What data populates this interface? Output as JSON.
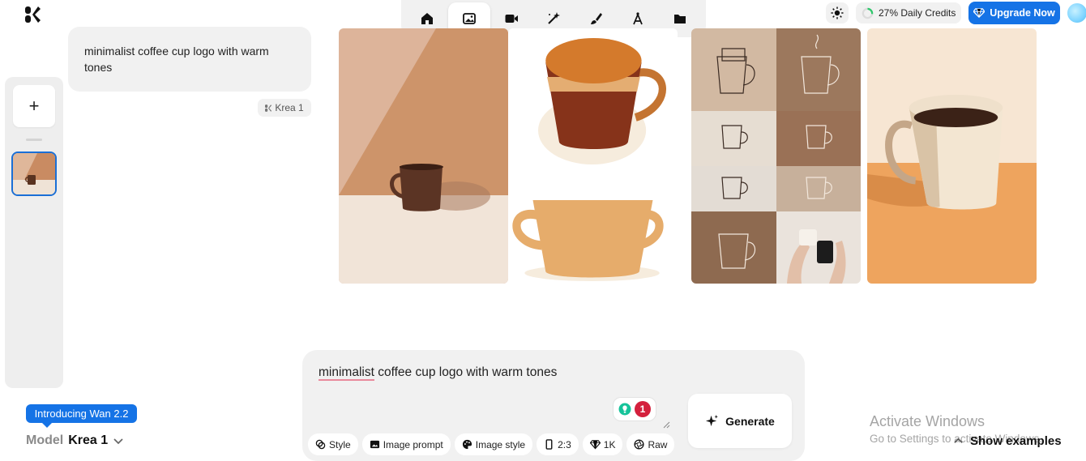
{
  "toolbar": {
    "items": [
      {
        "name": "home",
        "icon": "home-icon",
        "active": false
      },
      {
        "name": "image",
        "icon": "image-icon",
        "active": true
      },
      {
        "name": "video",
        "icon": "video-camera-icon",
        "active": false
      },
      {
        "name": "enhance",
        "icon": "magic-wand-icon",
        "active": false
      },
      {
        "name": "edit",
        "icon": "brush-icon",
        "active": false
      },
      {
        "name": "design",
        "icon": "compass-icon",
        "active": false
      },
      {
        "name": "assets",
        "icon": "folder-icon",
        "active": false
      }
    ]
  },
  "header": {
    "credits_label": "27% Daily Credits",
    "credits_percent": 27,
    "upgrade_label": "Upgrade Now",
    "accent_color": "#1573e6"
  },
  "sidebar": {
    "add_label": "+"
  },
  "chat": {
    "user_prompt": "minimalist coffee cup logo with warm tones",
    "model_tag": "Krea 1"
  },
  "composer": {
    "prompt_first_word": "minimalist",
    "prompt_rest": " coffee cup logo with warm tones",
    "extension_badge_count": "1",
    "chips": [
      {
        "label": "Style",
        "icon": "style-icon"
      },
      {
        "label": "Image prompt",
        "icon": "image-prompt-icon"
      },
      {
        "label": "Image style",
        "icon": "palette-icon"
      },
      {
        "label": "2:3",
        "icon": "aspect-ratio-icon"
      },
      {
        "label": "1K",
        "icon": "diamond-icon"
      },
      {
        "label": "Raw",
        "icon": "aperture-icon"
      }
    ],
    "generate_label": "Generate"
  },
  "footer": {
    "intro_tip": "Introducing Wan 2.2",
    "model_label": "Model",
    "model_name": "Krea 1",
    "activate_title": "Activate Windows",
    "activate_sub": "Go to Settings to activate Windows.",
    "show_examples": "Show examples"
  }
}
